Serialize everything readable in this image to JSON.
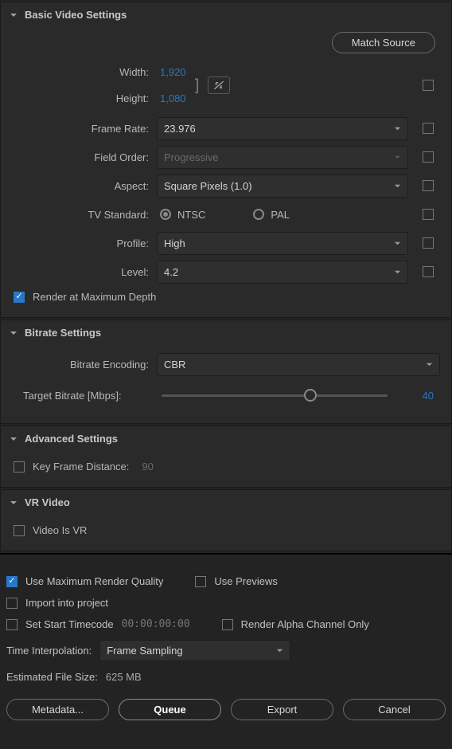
{
  "basic": {
    "title": "Basic Video Settings",
    "match_source": "Match Source",
    "width_label": "Width:",
    "width_value": "1,920",
    "height_label": "Height:",
    "height_value": "1,080",
    "frame_rate_label": "Frame Rate:",
    "frame_rate_value": "23.976",
    "field_order_label": "Field Order:",
    "field_order_value": "Progressive",
    "aspect_label": "Aspect:",
    "aspect_value": "Square Pixels (1.0)",
    "tv_standard_label": "TV Standard:",
    "ntsc": "NTSC",
    "pal": "PAL",
    "profile_label": "Profile:",
    "profile_value": "High",
    "level_label": "Level:",
    "level_value": "4.2",
    "render_max_depth": "Render at Maximum Depth"
  },
  "bitrate": {
    "title": "Bitrate Settings",
    "encoding_label": "Bitrate Encoding:",
    "encoding_value": "CBR",
    "target_label": "Target Bitrate [Mbps]:",
    "target_value": "40",
    "slider_percent": 66
  },
  "advanced": {
    "title": "Advanced Settings",
    "kfd_label": "Key Frame Distance:",
    "kfd_value": "90"
  },
  "vr": {
    "title": "VR Video",
    "is_vr": "Video Is VR"
  },
  "bottom": {
    "max_render": "Use Maximum Render Quality",
    "use_previews": "Use Previews",
    "import_project": "Import into project",
    "set_start_tc": "Set Start Timecode",
    "tc_value": "00:00:00:00",
    "render_alpha": "Render Alpha Channel Only",
    "time_interp_label": "Time Interpolation:",
    "time_interp_value": "Frame Sampling",
    "est_size_label": "Estimated File Size:",
    "est_size_value": "625 MB",
    "metadata": "Metadata...",
    "queue": "Queue",
    "export": "Export",
    "cancel": "Cancel"
  }
}
